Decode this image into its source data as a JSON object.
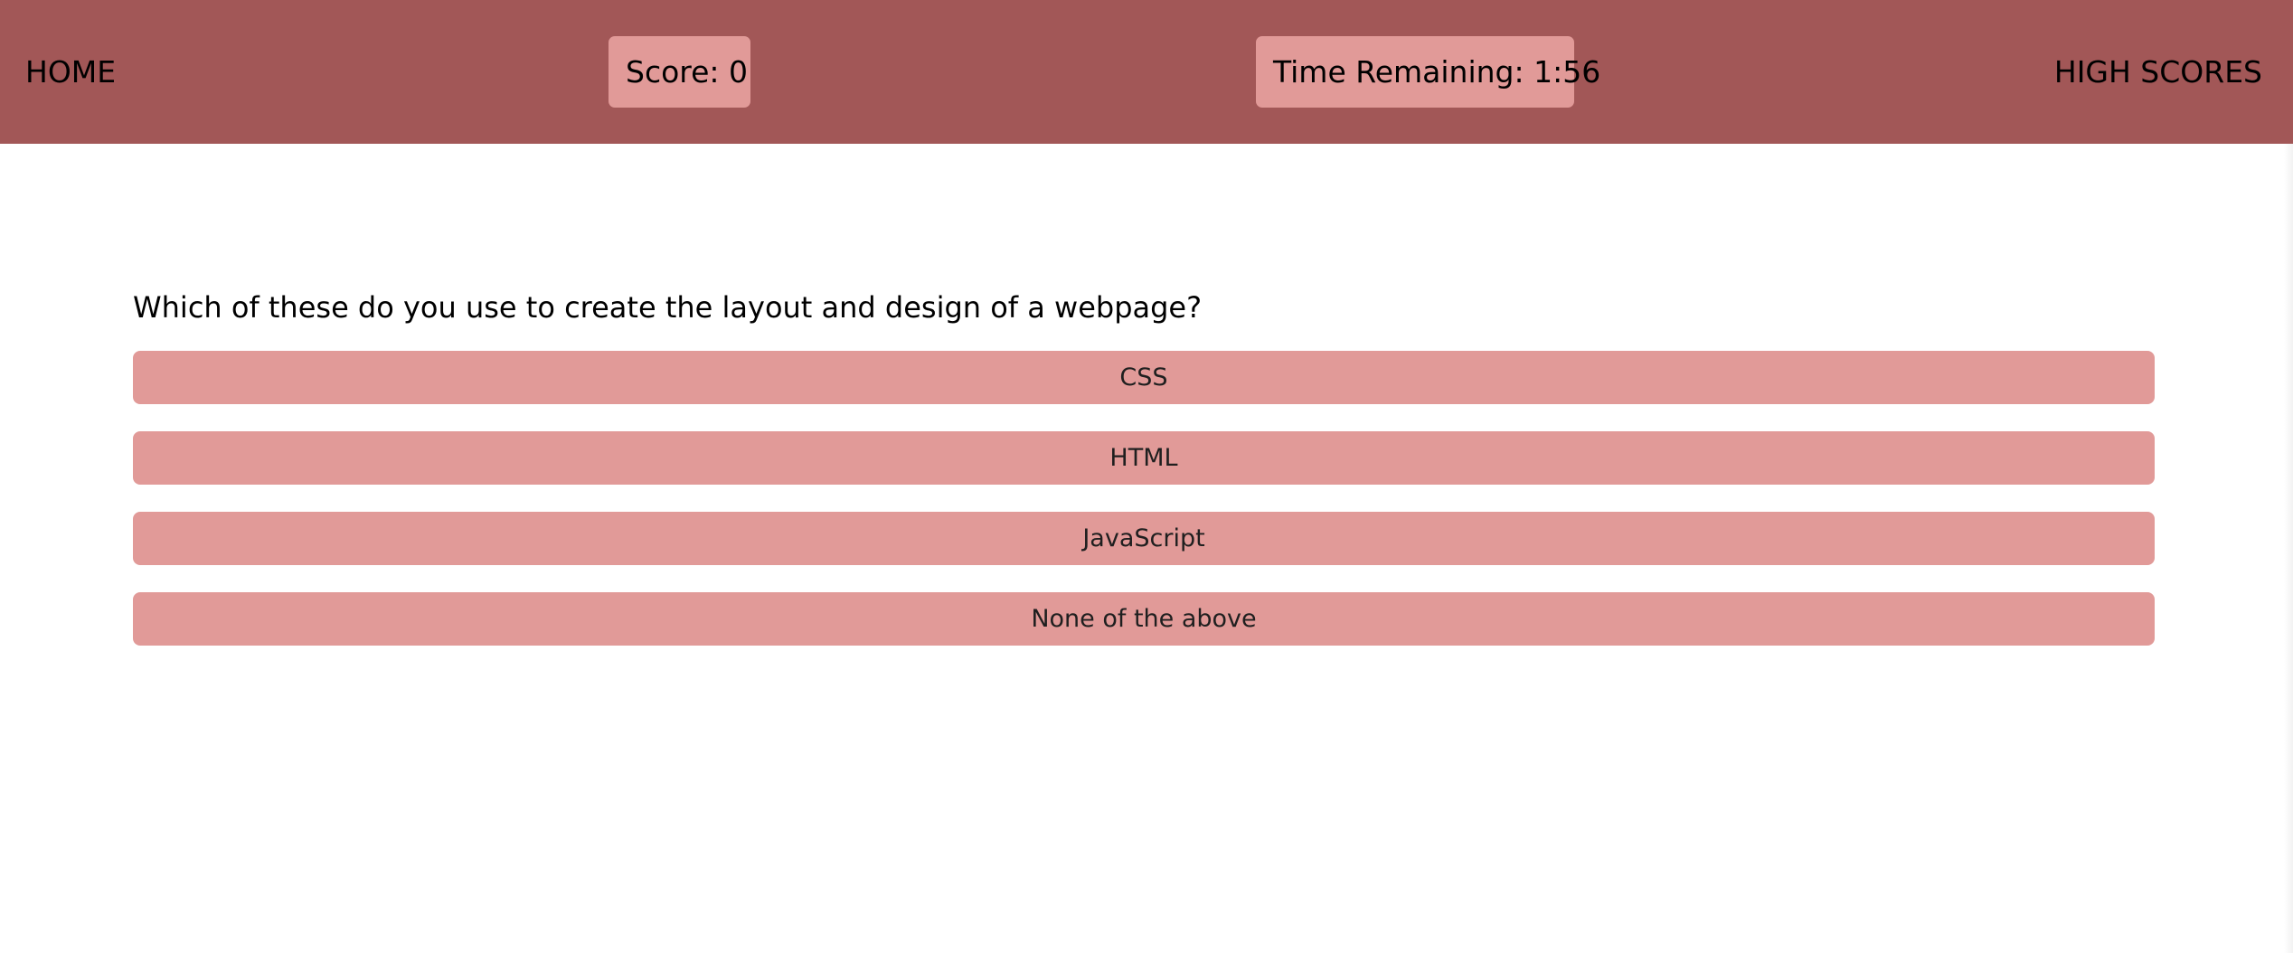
{
  "header": {
    "home_label": "HOME",
    "score_text": "Score: 0",
    "timer_text": "Time Remaining: 1:56",
    "high_scores_label": "HIGH SCORES"
  },
  "quiz": {
    "question": "Which of these do you use to create the layout and design of a webpage?",
    "answers": [
      {
        "label": "CSS"
      },
      {
        "label": "HTML"
      },
      {
        "label": "JavaScript"
      },
      {
        "label": "None of the above"
      }
    ]
  },
  "colors": {
    "header_bg": "#a25757",
    "accent_bg": "#e19a98",
    "page_bg": "#ffffff",
    "text": "#000000"
  }
}
